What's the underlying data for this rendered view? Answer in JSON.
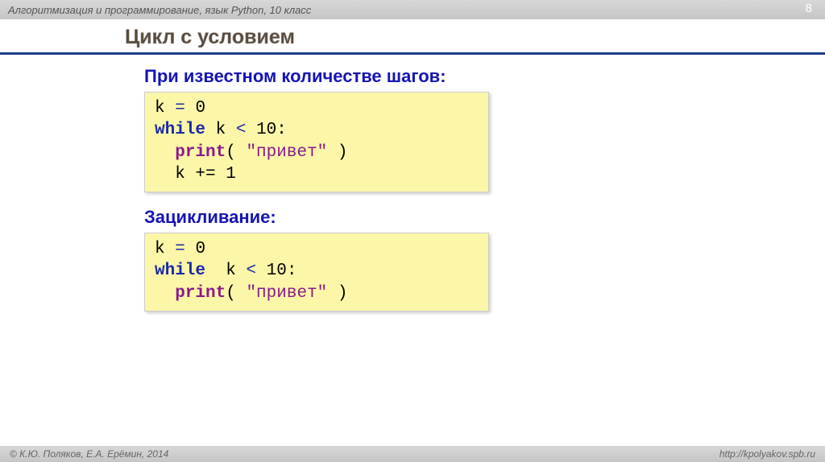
{
  "header": {
    "title": "Алгоритмизация и программирование, язык Python, 10 класс",
    "page": "8"
  },
  "title": "Цикл с условием",
  "section1": {
    "subtitle": "При известном количестве шагов:",
    "code": {
      "l1a": "k",
      "l1b": "=",
      "l1c": "0",
      "l2a": "while",
      "l2b": " k",
      "l2c": "<",
      "l2d": "10",
      "l2e": ":",
      "l3a": "  ",
      "l3b": "print",
      "l3c": "( ",
      "l3d": "\"привет\"",
      "l3e": " )",
      "l4": "  k += 1"
    }
  },
  "section2": {
    "subtitle": "Зацикливание:",
    "code": {
      "l1a": "k",
      "l1b": "=",
      "l1c": "0",
      "l2a": "while",
      "l2b": "  k",
      "l2c": "<",
      "l2d": "10",
      "l2e": ":",
      "l3a": "  ",
      "l3b": "print",
      "l3c": "( ",
      "l3d": "\"привет\"",
      "l3e": " )"
    }
  },
  "footer": {
    "copyright": "© К.Ю. Поляков, Е.А. Ерёмин, 2014",
    "url": "http://kpolyakov.spb.ru"
  }
}
